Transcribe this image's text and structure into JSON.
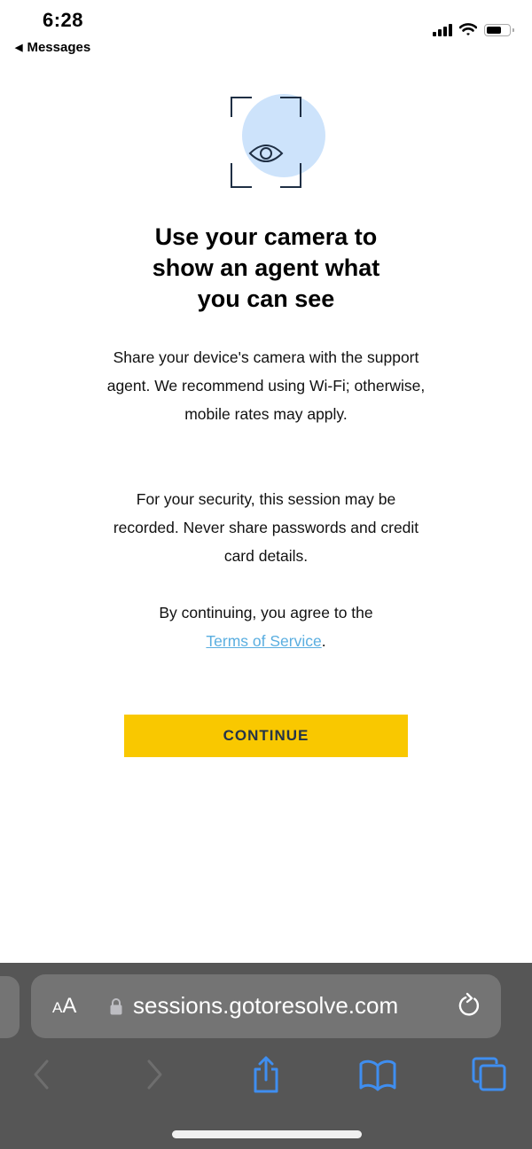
{
  "status_bar": {
    "time": "6:28",
    "back_label": "Messages",
    "icons": [
      "signal-icon",
      "wifi-icon",
      "battery-icon"
    ]
  },
  "hero": {
    "icon": "camera-eye-icon",
    "accent_color": "#cde3fb"
  },
  "content": {
    "title_lines": [
      "Use your camera to",
      "show an agent what",
      "you can see"
    ],
    "paragraph_1": "Share your device's camera with the support agent. We recommend using Wi-Fi; otherwise, mobile rates may apply.",
    "paragraph_2": "For your security, this session may be recorded. Never share passwords and credit card details.",
    "paragraph_3_prefix": "By continuing, you agree to the",
    "terms_link": "Terms of Service",
    "paragraph_3_suffix": ".",
    "continue_button": "CONTINUE",
    "button_color": "#f9c800"
  },
  "browser": {
    "text_size_small": "A",
    "text_size_big": "A",
    "url": "sessions.gotoresolve.com",
    "toolbar": [
      "back-icon",
      "forward-icon",
      "share-icon",
      "bookmarks-icon",
      "tabs-icon"
    ],
    "accent_color": "#3f8ef0"
  }
}
